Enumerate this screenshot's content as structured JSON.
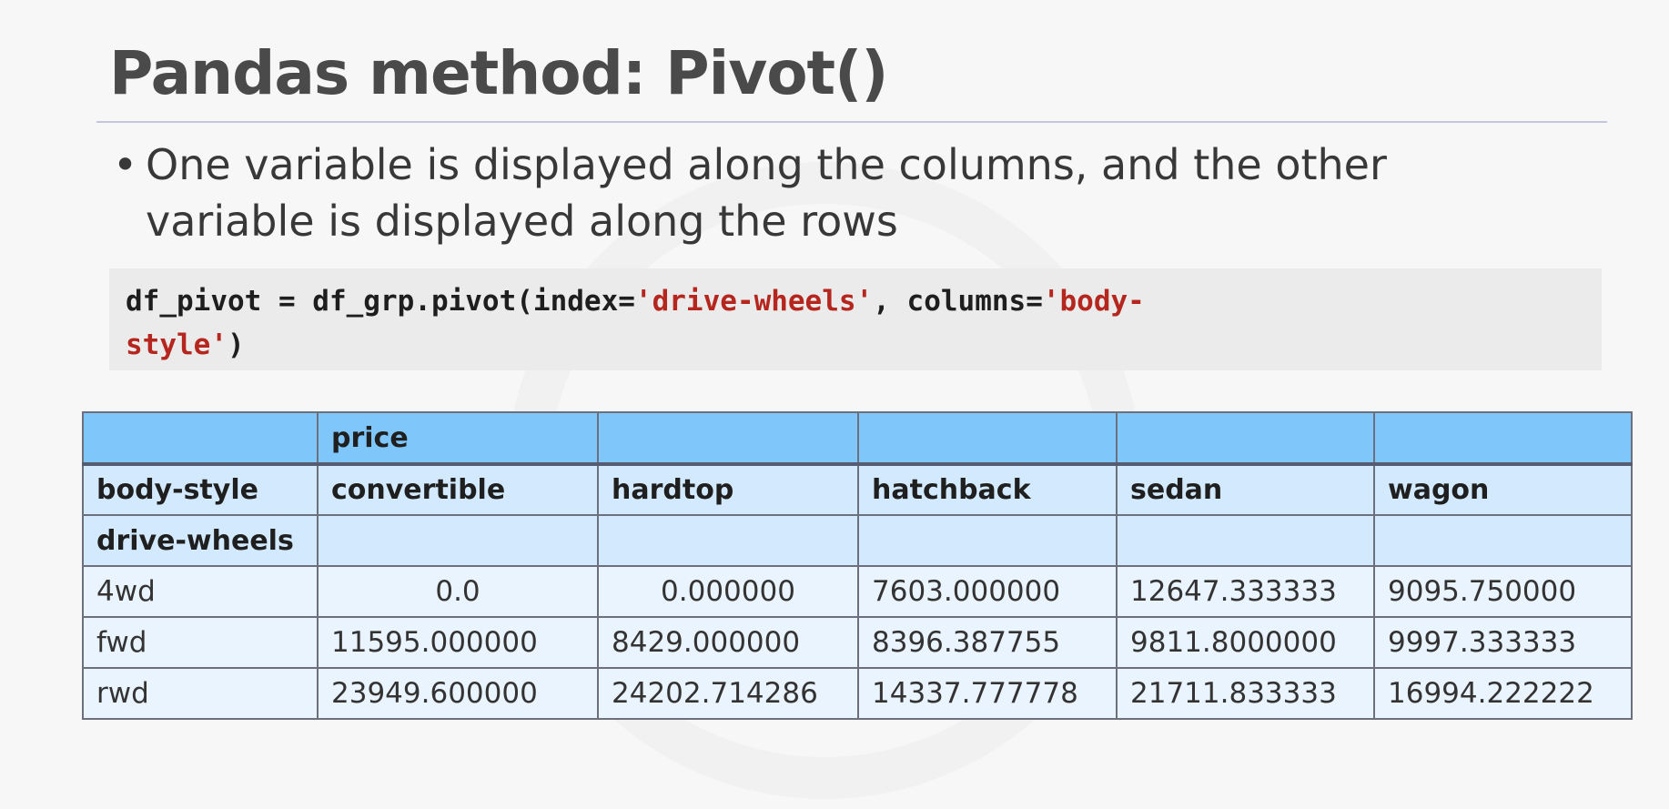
{
  "title": "Pandas method: Pivot()",
  "bullet": {
    "line1": "One variable is displayed along the columns, and the other",
    "line2": "variable is displayed along the rows"
  },
  "code": {
    "p1": "df_pivot = df_grp.pivot(index=",
    "s1": "'drive-wheels'",
    "p2": ", columns=",
    "s2a": "'body-",
    "s2b": "style'",
    "p3": ")"
  },
  "table": {
    "top_row": [
      "",
      "price",
      "",
      "",
      "",
      ""
    ],
    "header_row": [
      "body-style",
      "convertible",
      "hardtop",
      "hatchback",
      "sedan",
      "wagon"
    ],
    "index_row": [
      "drive-wheels",
      "",
      "",
      "",
      "",
      ""
    ],
    "rows": [
      [
        "4wd",
        "0.0",
        "0.000000",
        "7603.000000",
        "12647.333333",
        "9095.750000"
      ],
      [
        "fwd",
        "11595.000000",
        "8429.000000",
        "8396.387755",
        "9811.8000000",
        "9997.333333"
      ],
      [
        "rwd",
        "23949.600000",
        "24202.714286",
        "14337.777778",
        "21711.833333",
        "16994.222222"
      ]
    ]
  }
}
